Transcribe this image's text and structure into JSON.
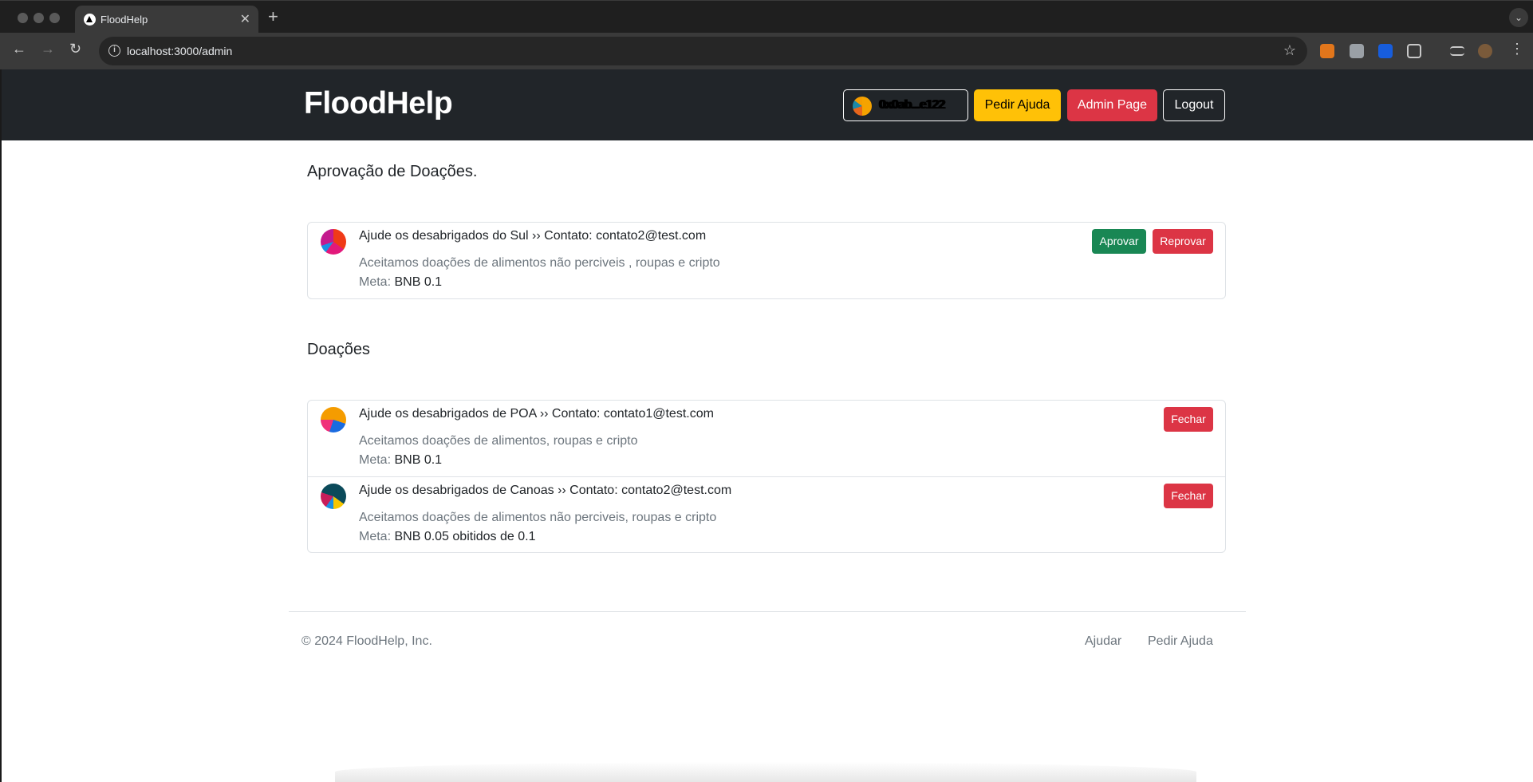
{
  "browser": {
    "tab_title": "FloodHelp",
    "url": "localhost:3000/admin",
    "new_tab": "+",
    "close_tab": "✕",
    "tabs_menu": "⌄"
  },
  "header": {
    "brand": "FloodHelp",
    "wallet_label": "0x0ab...e122",
    "pedir_ajuda": "Pedir Ajuda",
    "admin_page": "Admin Page",
    "logout": "Logout"
  },
  "approval": {
    "title": "Aprovação de Doações.",
    "items": [
      {
        "title": "Ajude os desabrigados do Sul ›› Contato: contato2@test.com",
        "description": "Aceitamos doações de alimentos não perciveis , roupas e cripto",
        "meta_label": "Meta: ",
        "meta_value": "BNB 0.1",
        "approve_label": "Aprovar",
        "reject_label": "Reprovar"
      }
    ]
  },
  "donations": {
    "title": "Doações",
    "items": [
      {
        "title": "Ajude os desabrigados de POA ›› Contato: contato1@test.com",
        "description": "Aceitamos doações de alimentos, roupas e cripto",
        "meta_label": "Meta: ",
        "meta_value": "BNB 0.1",
        "close_label": "Fechar"
      },
      {
        "title": "Ajude os desabrigados de Canoas ›› Contato: contato2@test.com",
        "description": "Aceitamos doações de alimentos não perciveis, roupas e cripto",
        "meta_label": "Meta: ",
        "meta_value": "BNB 0.05 obitidos de 0.1",
        "close_label": "Fechar"
      }
    ]
  },
  "footer": {
    "copyright": "© 2024 FloodHelp, Inc.",
    "links": [
      "Ajudar",
      "Pedir Ajuda"
    ]
  },
  "colors": {
    "header_bg": "#212529",
    "warning": "#ffc107",
    "danger": "#dc3545",
    "success": "#198754"
  }
}
